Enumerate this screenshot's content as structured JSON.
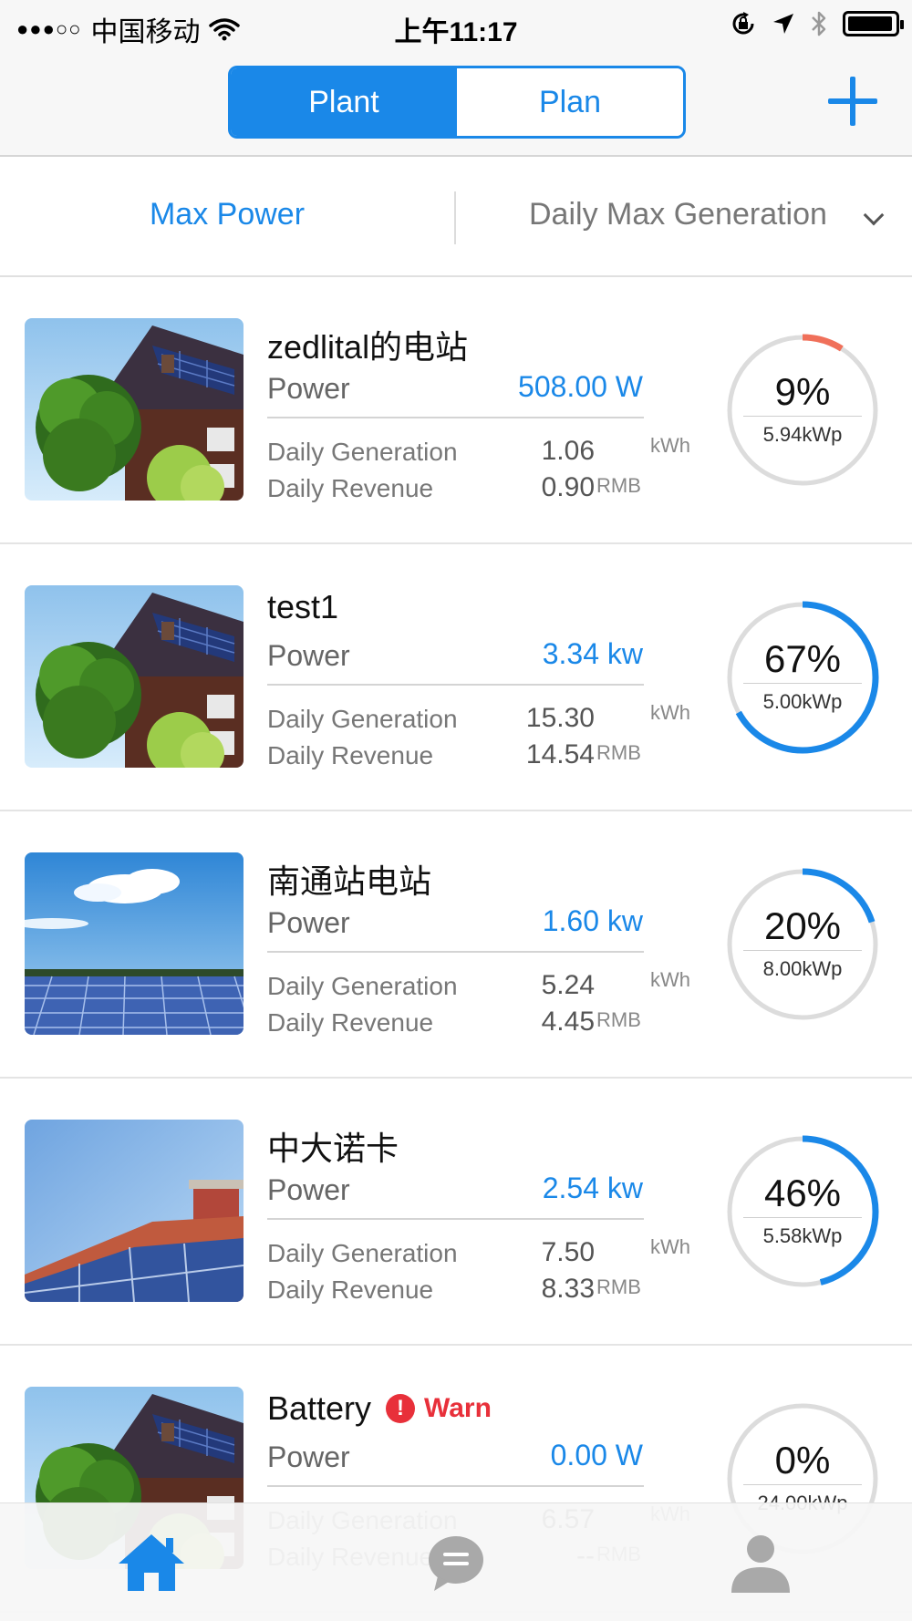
{
  "status_bar": {
    "signal": "●●●○○",
    "carrier": "中国移动",
    "time": "上午11:17"
  },
  "nav": {
    "tabs": [
      {
        "label": "Plant",
        "active": true
      },
      {
        "label": "Plan",
        "active": false
      }
    ],
    "add_icon": "plus-icon"
  },
  "sort": {
    "left": "Max Power",
    "right": "Daily Max Generation"
  },
  "labels": {
    "power": "Power",
    "daily_generation": "Daily Generation",
    "daily_revenue": "Daily Revenue",
    "gen_unit": "kWh",
    "rev_unit": "RMB"
  },
  "plants": [
    {
      "name": "zedlital的电站",
      "power": "508.00  W",
      "daily_generation": "1.06",
      "daily_revenue": "0.90",
      "percent": "9%",
      "capacity": "5.94kWp",
      "ratio": 0.09,
      "ring_color": "#f0705a",
      "photo": "house"
    },
    {
      "name": "test1",
      "power": "3.34  kw",
      "daily_generation": "15.30",
      "daily_revenue": "14.54",
      "percent": "67%",
      "capacity": "5.00kWp",
      "ratio": 0.67,
      "ring_color": "#1a88e8",
      "photo": "house"
    },
    {
      "name": "南通站电站",
      "power": "1.60  kw",
      "daily_generation": "5.24",
      "daily_revenue": "4.45",
      "percent": "20%",
      "capacity": "8.00kWp",
      "ratio": 0.2,
      "ring_color": "#1a88e8",
      "photo": "field"
    },
    {
      "name": "中大诺卡",
      "power": "2.54  kw",
      "daily_generation": "7.50",
      "daily_revenue": "8.33",
      "percent": "46%",
      "capacity": "5.58kWp",
      "ratio": 0.46,
      "ring_color": "#1a88e8",
      "photo": "roof"
    },
    {
      "name": "Battery",
      "warn": "Warn",
      "power": "0.00  W",
      "daily_generation": "6.57",
      "daily_revenue": "--",
      "percent": "0%",
      "capacity": "24.00kWp",
      "ratio": 0.0,
      "ring_color": "#1a88e8",
      "photo": "house"
    }
  ],
  "tabbar": {
    "items": [
      {
        "icon": "home-icon",
        "active": true,
        "color": "#1a88e8"
      },
      {
        "icon": "message-icon",
        "active": false,
        "color": "#a9a9a9"
      },
      {
        "icon": "user-icon",
        "active": false,
        "color": "#a9a9a9"
      }
    ]
  }
}
